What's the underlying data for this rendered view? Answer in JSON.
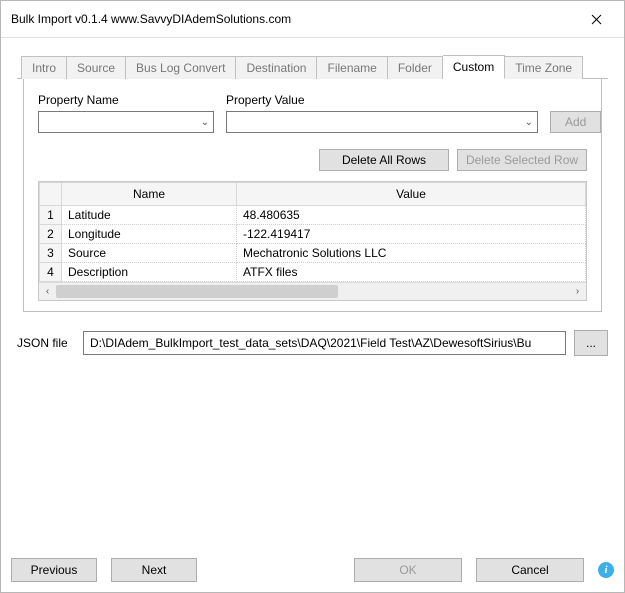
{
  "window": {
    "title": "Bulk Import v0.1.4   www.SavvyDIAdemSolutions.com"
  },
  "tabs": [
    {
      "id": "intro",
      "label": "Intro",
      "active": false
    },
    {
      "id": "source",
      "label": "Source",
      "active": false
    },
    {
      "id": "buslog",
      "label": "Bus Log Convert",
      "active": false
    },
    {
      "id": "destination",
      "label": "Destination",
      "active": false
    },
    {
      "id": "filename",
      "label": "Filename",
      "active": false
    },
    {
      "id": "folder",
      "label": "Folder",
      "active": false
    },
    {
      "id": "custom",
      "label": "Custom",
      "active": true
    },
    {
      "id": "timezone",
      "label": "Time Zone",
      "active": false
    }
  ],
  "fields": {
    "property_name_label": "Property Name",
    "property_value_label": "Property Value",
    "property_name_value": "",
    "property_value_value": ""
  },
  "buttons": {
    "add": "Add",
    "delete_all": "Delete All Rows",
    "delete_selected": "Delete Selected Row",
    "previous": "Previous",
    "next": "Next",
    "ok": "OK",
    "cancel": "Cancel",
    "browse": "..."
  },
  "table": {
    "columns": [
      "",
      "Name",
      "Value"
    ],
    "rows": [
      {
        "num": "1",
        "name": "Latitude",
        "value": "48.480635"
      },
      {
        "num": "2",
        "name": "Longitude",
        "value": "-122.419417"
      },
      {
        "num": "3",
        "name": "Source",
        "value": "Mechatronic Solutions LLC"
      },
      {
        "num": "4",
        "name": "Description",
        "value": "ATFX files"
      }
    ]
  },
  "json_file": {
    "label": "JSON file",
    "path": "D:\\DIAdem_BulkImport_test_data_sets\\DAQ\\2021\\Field Test\\AZ\\DewesoftSirius\\Bu"
  }
}
